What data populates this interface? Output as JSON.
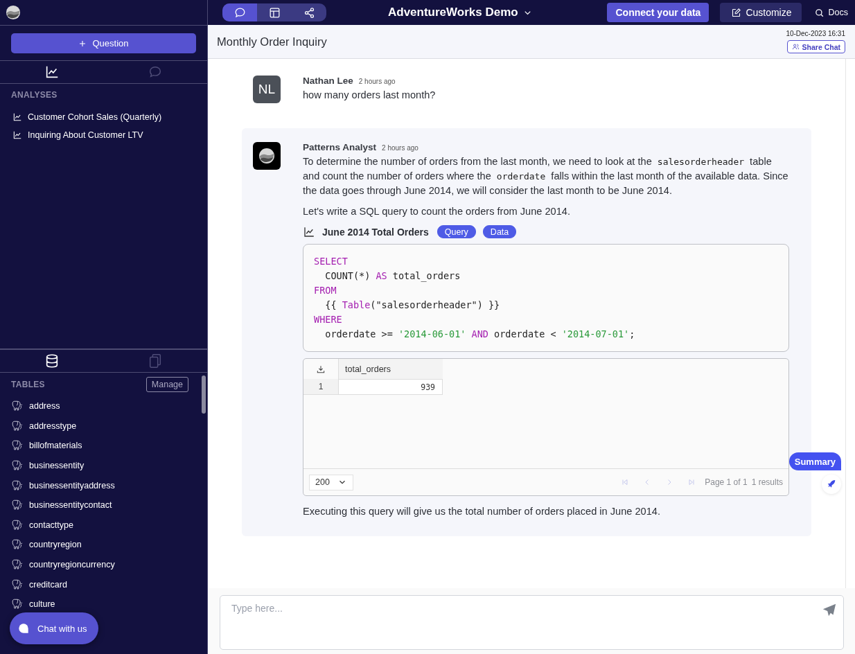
{
  "sidebar": {
    "new_button": {
      "label": "Question"
    },
    "top_tabs": [
      {
        "selected": true
      },
      {
        "selected": false
      }
    ],
    "analyses": {
      "heading": "ANALYSES",
      "items": [
        {
          "label": "Customer Cohort Sales (Quarterly)"
        },
        {
          "label": "Inquiring About Customer LTV"
        }
      ]
    },
    "bottom_tabs": [
      {
        "selected": true
      },
      {
        "selected": false
      }
    ],
    "tables": {
      "heading": "TABLES",
      "manage_button": "Manage",
      "items": [
        "address",
        "addresstype",
        "billofmaterials",
        "businessentity",
        "businessentityaddress",
        "businessentitycontact",
        "contacttype",
        "countryregion",
        "countryregioncurrency",
        "creditcard",
        "culture"
      ]
    },
    "chat_widget": {
      "label": "Chat with us"
    }
  },
  "toolbar": {
    "views": [
      {
        "selected": true
      },
      {
        "selected": false
      },
      {
        "selected": false
      }
    ],
    "project": "AdventureWorks Demo",
    "connect_button": "Connect your data",
    "customize_button": "Customize",
    "docs_link": "Docs"
  },
  "header": {
    "title": "Monthly Order Inquiry",
    "timestamp": "10-Dec-2023 16:31",
    "share_button": "Share Chat"
  },
  "messages": [
    {
      "kind": "user",
      "author": "Nathan Lee",
      "initials": "NL",
      "time": "2 hours ago",
      "blocks": [
        {
          "kind": "paragraph",
          "segments": [
            {
              "kind": "text",
              "text": "how many orders last month?"
            }
          ]
        }
      ]
    },
    {
      "kind": "assistant",
      "author": "Patterns Analyst",
      "time": "2 hours ago",
      "blocks": [
        {
          "kind": "paragraph",
          "segments": [
            {
              "kind": "text",
              "text": "To determine the number of orders from the last month, we need to look at the "
            },
            {
              "kind": "code",
              "text": "salesorderheader"
            },
            {
              "kind": "text",
              "text": " table and count the number of orders where the "
            },
            {
              "kind": "code",
              "text": "orderdate"
            },
            {
              "kind": "text",
              "text": " falls within the last month of the available data. Since the data goes through June 2014, we will consider the last month to be June 2014."
            }
          ]
        },
        {
          "kind": "paragraph",
          "segments": [
            {
              "kind": "text",
              "text": "Let's write a SQL query to count the orders from June 2014."
            }
          ]
        },
        {
          "kind": "result",
          "title": "June 2014 Total Orders",
          "toggles": [
            {
              "label": "Query",
              "on": true
            },
            {
              "label": "Data",
              "on": true
            }
          ],
          "code": [
            [
              {
                "kind": "keyword",
                "text": "SELECT"
              }
            ],
            [
              {
                "kind": "plain",
                "text": "  COUNT(*) "
              },
              {
                "kind": "keyword",
                "text": "AS"
              },
              {
                "kind": "plain",
                "text": " total_orders"
              }
            ],
            [
              {
                "kind": "keyword",
                "text": "FROM"
              }
            ],
            [
              {
                "kind": "plain",
                "text": "  {{ "
              },
              {
                "kind": "keyword",
                "text": "Table"
              },
              {
                "kind": "plain",
                "text": "(\"salesorderheader\") }}"
              }
            ],
            [
              {
                "kind": "keyword",
                "text": "WHERE"
              }
            ],
            [
              {
                "kind": "plain",
                "text": "  orderdate >= "
              },
              {
                "kind": "string",
                "text": "'2014-06-01'"
              },
              {
                "kind": "keyword",
                "text": " AND"
              },
              {
                "kind": "plain",
                "text": " orderdate < "
              },
              {
                "kind": "string",
                "text": "'2014-07-01'"
              },
              {
                "kind": "plain",
                "text": ";"
              }
            ]
          ],
          "table": {
            "columns": [
              "total_orders"
            ],
            "rows": [
              {
                "index": "1",
                "cells": [
                  "939"
                ]
              }
            ],
            "page_size": "200",
            "pager": [
              {
                "disabled": true
              },
              {
                "disabled": true
              },
              {
                "disabled": true
              },
              {
                "disabled": true
              }
            ],
            "page_label": "Page 1 of 1",
            "results": "1 results"
          }
        },
        {
          "kind": "paragraph",
          "segments": [
            {
              "kind": "text",
              "text": "Executing this query will give us the total number of orders placed in June 2014."
            }
          ]
        }
      ]
    }
  ],
  "summary_tab": {
    "label": "Summary"
  },
  "composer": {
    "placeholder": "Type here..."
  }
}
